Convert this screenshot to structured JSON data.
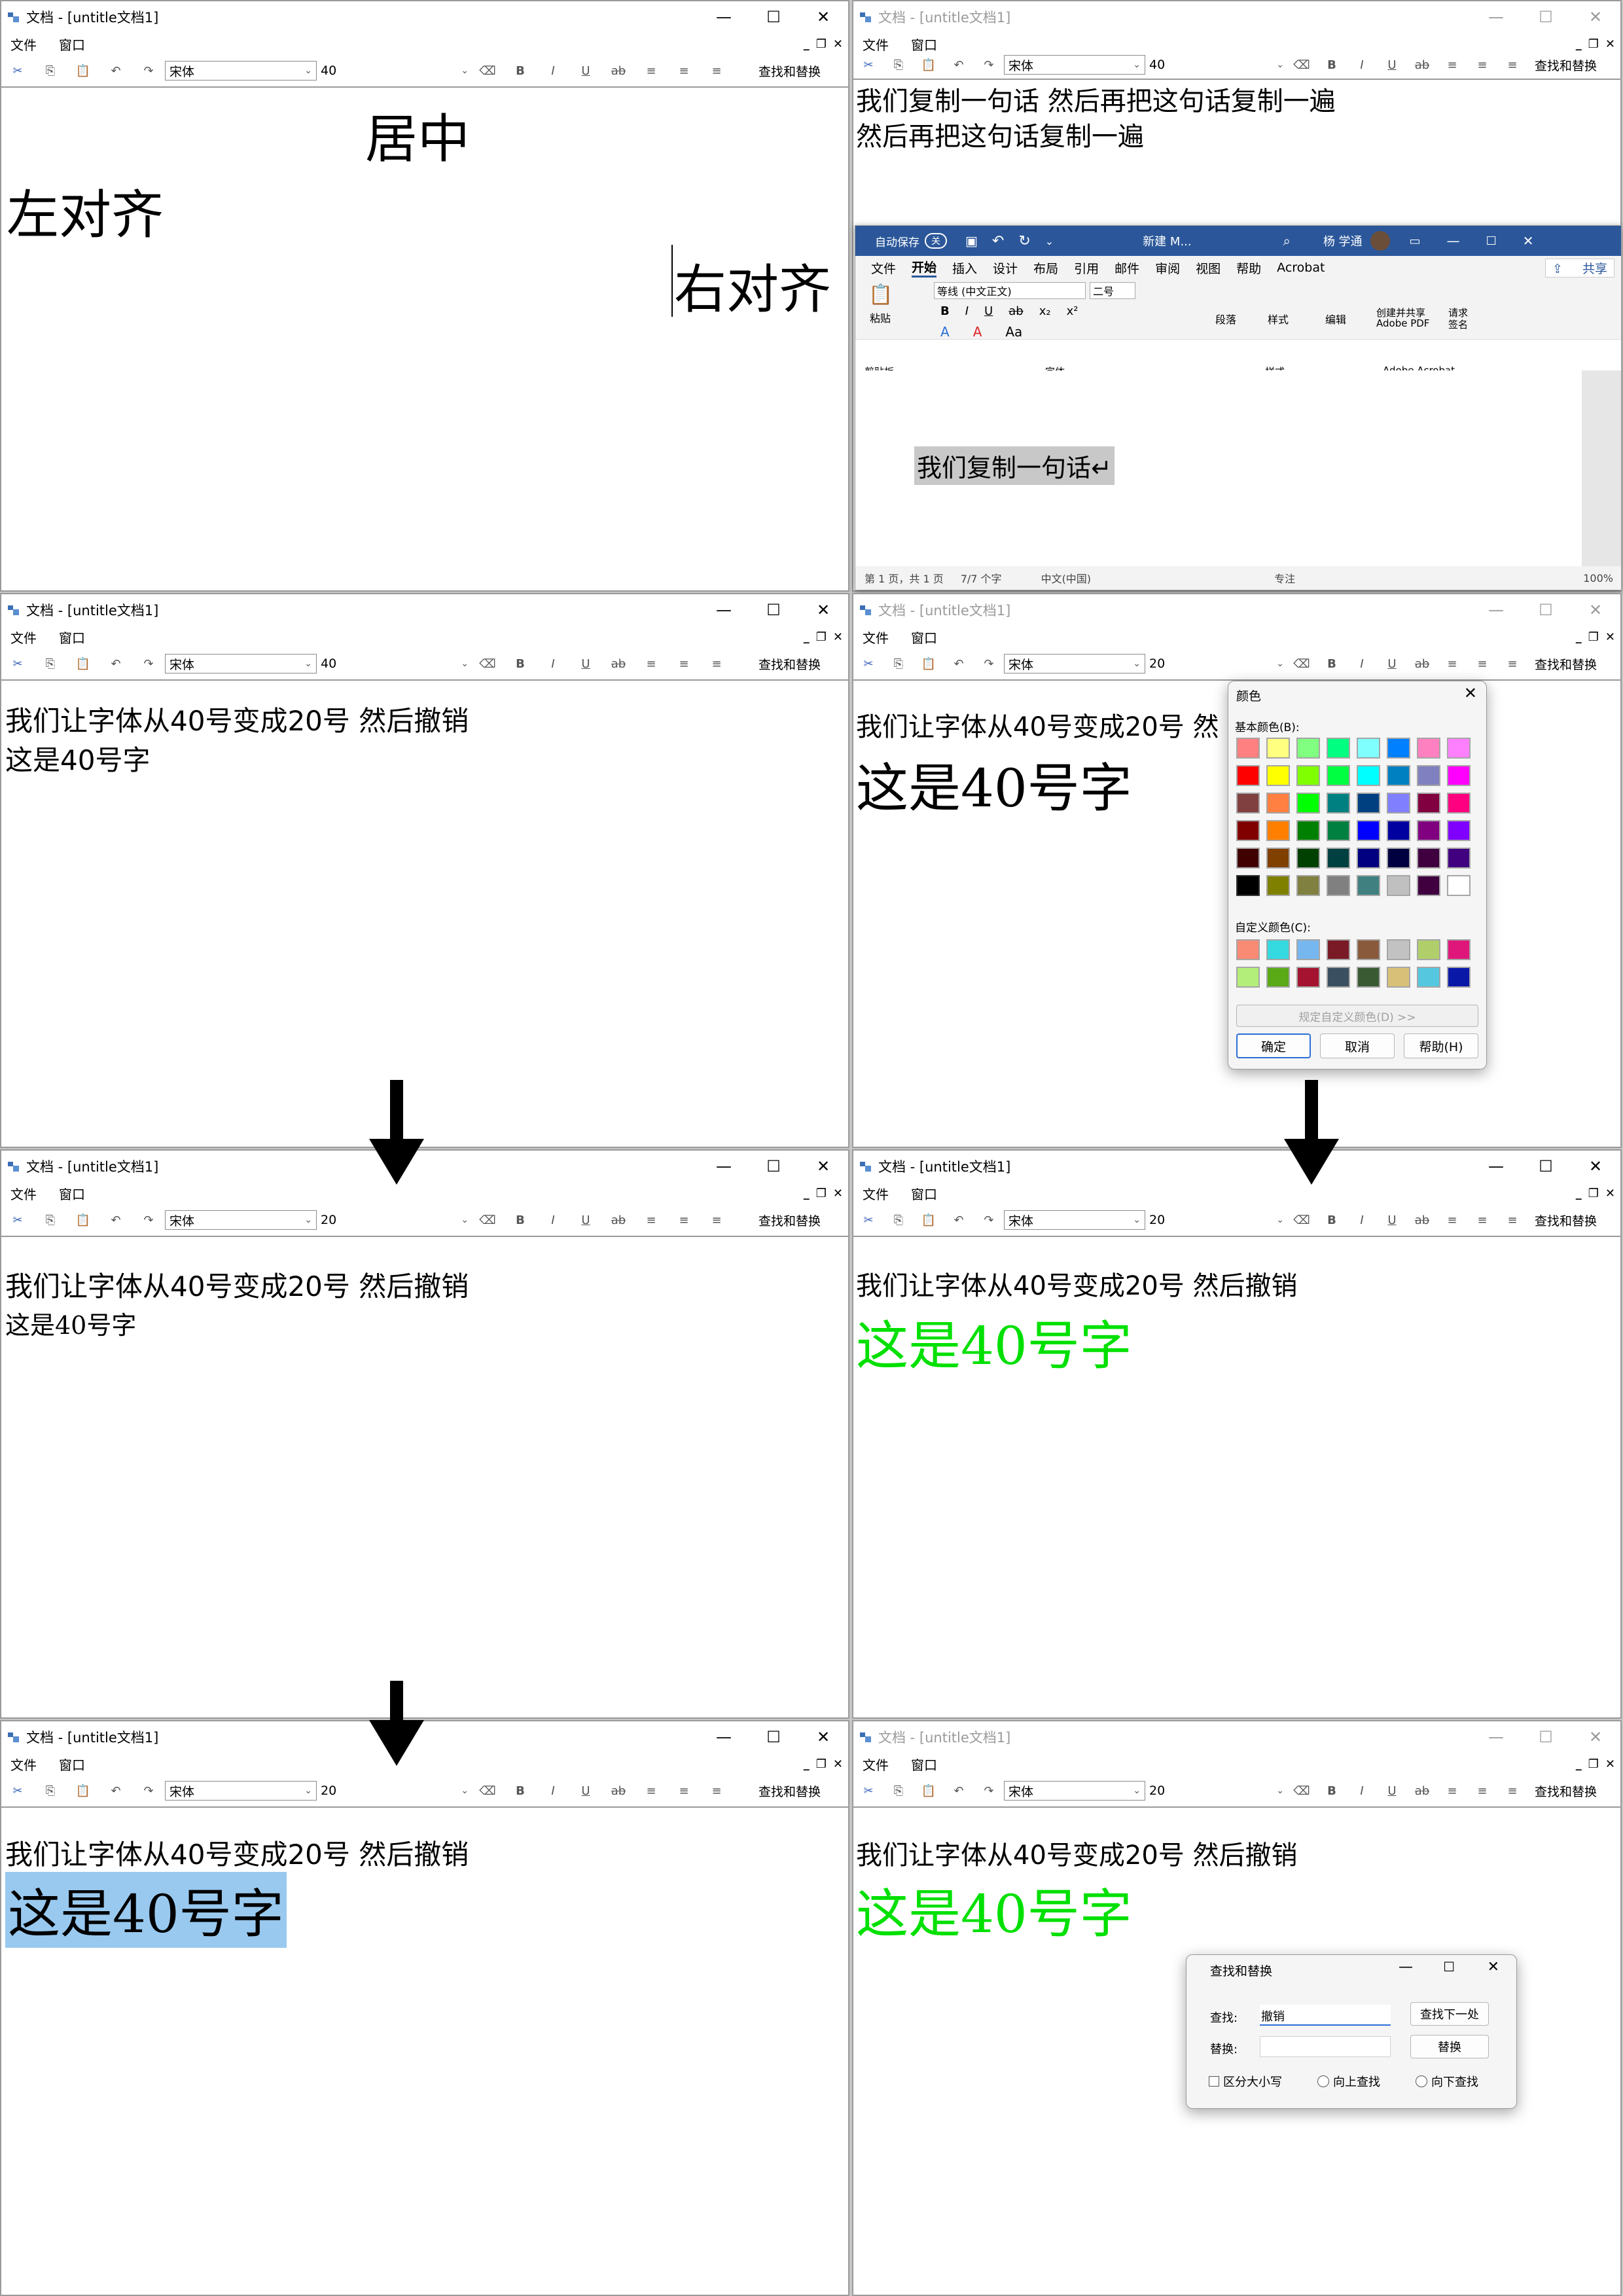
{
  "app": {
    "title": "文档 - [untitle文档1]",
    "menu": [
      "文件",
      "窗口"
    ],
    "mdi_controls": [
      "_",
      "❐",
      "✕"
    ],
    "window_controls": [
      "—",
      "☐",
      "✕"
    ],
    "font_name": "宋体",
    "find_replace_label": "查找和替换",
    "tool_glyphs": {
      "cut": "✂",
      "copy": "⎘",
      "paste": "📋",
      "undo": "↶",
      "redo": "↷",
      "eraser": "⌫",
      "bold": "B",
      "italic": "I",
      "underline": "U",
      "strike": "ab",
      "align_left": "≡",
      "align_center": "≡",
      "align_right": "≡",
      "dropdown": "⌄"
    }
  },
  "panels": [
    {
      "id": "p1",
      "font_size": "40",
      "active": true,
      "lines": [
        "居中",
        "左对齐",
        "右对齐"
      ]
    },
    {
      "id": "p2",
      "font_size": "40",
      "active": false,
      "lines": [
        "我们复制一句话  然后再把这句话复制一遍",
        "然后再把这句话复制一遍"
      ]
    },
    {
      "id": "p3",
      "font_size": "40",
      "active": true,
      "lines": [
        "我们让字体从40号变成20号  然后撤销",
        "这是40号字"
      ]
    },
    {
      "id": "p4",
      "font_size": "20",
      "active": false,
      "lines": [
        "我们让字体从40号变成20号  然",
        "这是40号字"
      ]
    },
    {
      "id": "p5",
      "font_size": "20",
      "active": true,
      "lines": [
        "我们让字体从40号变成20号  然后撤销",
        "这是40号字"
      ]
    },
    {
      "id": "p6",
      "font_size": "20",
      "active": true,
      "lines": [
        "我们让字体从40号变成20号  然后撤销",
        "这是40号字"
      ]
    },
    {
      "id": "p7",
      "font_size": "20",
      "active": true,
      "lines": [
        "我们让字体从40号变成20号  然后撤销",
        "这是40号字"
      ]
    },
    {
      "id": "p8",
      "font_size": "20",
      "active": false,
      "lines": [
        "我们让字体从40号变成20号  然后撤销",
        "这是40号字"
      ]
    }
  ],
  "word": {
    "autosave": "自动保存",
    "autosave_state": "关",
    "doc_name": "新建 M...",
    "user": "杨 学通",
    "tabs": [
      "文件",
      "开始",
      "插入",
      "设计",
      "布局",
      "引用",
      "邮件",
      "审阅",
      "视图",
      "帮助",
      "Acrobat"
    ],
    "active_tab": "开始",
    "share": "共享",
    "paste": "粘贴",
    "clipboard": "剪贴板",
    "font_name": "等线 (中文正文)",
    "font_size": "二号",
    "font_group": "字体",
    "paragraph": "段落",
    "styles": "样式",
    "styles_group": "样式",
    "editing": "编辑",
    "create_share": "创建并共享",
    "adobe_pdf": "Adobe PDF",
    "request_sign": "请求",
    "sign": "签名",
    "adobe_acrobat": "Adobe Acrobat",
    "format_row1": [
      "B",
      "I",
      "U",
      "ab",
      "x₂",
      "x²"
    ],
    "format_row2": [
      "A",
      "A",
      "Aa"
    ],
    "doc_text": "我们复制一句话↵",
    "status_page": "第 1 页，共 1 页",
    "status_words": "7/7 个字",
    "status_lang": "中文(中国)",
    "status_focus": "专注",
    "zoom": "100%"
  },
  "color_dialog": {
    "title": "颜色",
    "basic_label": "基本颜色(B):",
    "custom_label": "自定义颜色(C):",
    "define_btn": "规定自定义颜色(D) >>",
    "ok": "确定",
    "cancel": "取消",
    "help": "帮助(H)",
    "basic_colors": [
      "#ff8080",
      "#ffff80",
      "#80ff80",
      "#00ff80",
      "#80ffff",
      "#0080ff",
      "#ff80c0",
      "#ff80ff",
      "#ff0000",
      "#ffff00",
      "#80ff00",
      "#00ff40",
      "#00ffff",
      "#0080c0",
      "#8080c0",
      "#ff00ff",
      "#804040",
      "#ff8040",
      "#00ff00",
      "#008080",
      "#004080",
      "#8080ff",
      "#800040",
      "#ff0080",
      "#800000",
      "#ff8000",
      "#008000",
      "#008040",
      "#0000ff",
      "#0000a0",
      "#800080",
      "#8000ff",
      "#400000",
      "#804000",
      "#004000",
      "#004040",
      "#000080",
      "#000040",
      "#400040",
      "#400080",
      "#000000",
      "#808000",
      "#808040",
      "#808080",
      "#408080",
      "#c0c0c0",
      "#400040",
      "#ffffff"
    ],
    "custom_colors": [
      "#f98a74",
      "#35d9e0",
      "#77b7f0",
      "#7a1a26",
      "#8a5a3c",
      "#c2c2c2",
      "#b0cf6a",
      "#e0177a",
      "#b4ee7a",
      "#5aaa18",
      "#a41430",
      "#3a5060",
      "#3a5a34",
      "#d8c078",
      "#55c8e0",
      "#0a18a8"
    ]
  },
  "find_dialog": {
    "title": "查找和替换",
    "find_label": "查找:",
    "find_value": "撤销",
    "replace_label": "替换:",
    "replace_value": "",
    "find_next": "查找下一处",
    "replace": "替换",
    "case_label": "区分大小写",
    "up_label": "向上查找",
    "down_label": "向下查找"
  },
  "colors": {
    "green_text": "#00e000",
    "selection": "#99c9ef",
    "word_blue": "#2b579a"
  }
}
